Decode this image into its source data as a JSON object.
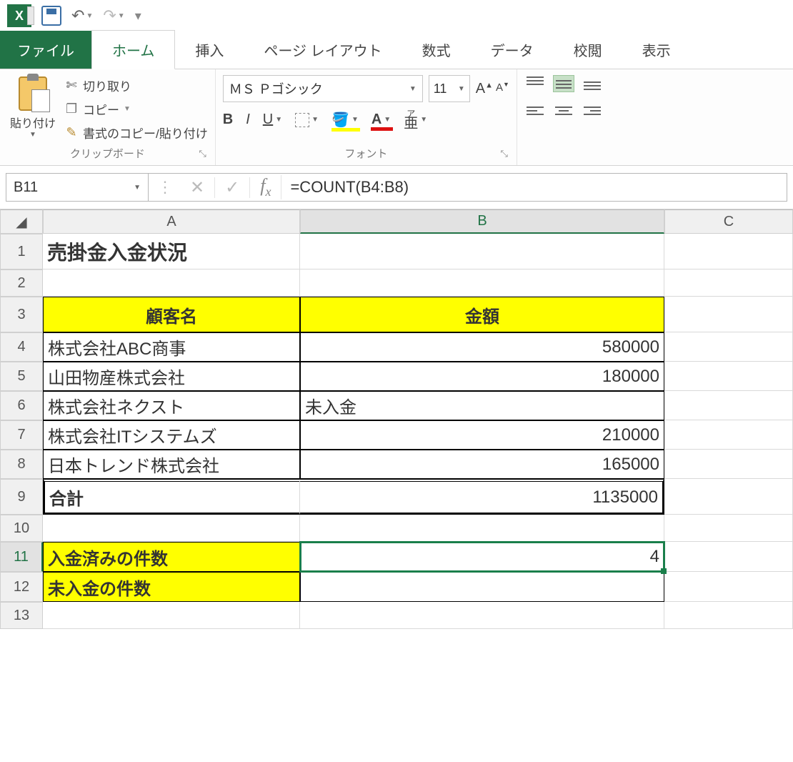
{
  "qat": {
    "undo": "↶",
    "redo": "↷"
  },
  "tabs": {
    "file": "ファイル",
    "home": "ホーム",
    "insert": "挿入",
    "pagelayout": "ページ レイアウト",
    "formulas": "数式",
    "data": "データ",
    "review": "校閲",
    "view": "表示"
  },
  "clipboard": {
    "paste": "貼り付け",
    "cut": "切り取り",
    "copy": "コピー",
    "formatpainter": "書式のコピー/貼り付け",
    "group_label": "クリップボード"
  },
  "font": {
    "name": "ＭＳ Ｐゴシック",
    "size": "11",
    "group_label": "フォント"
  },
  "namebox": "B11",
  "formula": "=COUNT(B4:B8)",
  "columns": {
    "A": "A",
    "B": "B",
    "C": "C"
  },
  "rows": [
    "1",
    "2",
    "3",
    "4",
    "5",
    "6",
    "7",
    "8",
    "9",
    "10",
    "11",
    "12",
    "13"
  ],
  "sheet": {
    "title": "売掛金入金状況",
    "header_a": "顧客名",
    "header_b": "金額",
    "r4a": "株式会社ABC商事",
    "r4b": "580000",
    "r5a": "山田物産株式会社",
    "r5b": "180000",
    "r6a": "株式会社ネクスト",
    "r6b": "未入金",
    "r7a": "株式会社ITシステムズ",
    "r7b": "210000",
    "r8a": "日本トレンド株式会社",
    "r8b": "165000",
    "r9a": "合計",
    "r9b": "1135000",
    "r11a": "入金済みの件数",
    "r11b": "4",
    "r12a": "未入金の件数",
    "r12b": ""
  }
}
